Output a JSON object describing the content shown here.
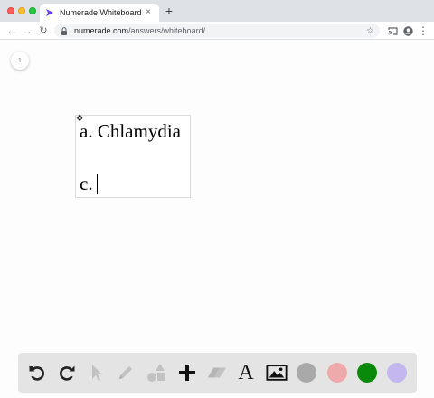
{
  "browser": {
    "tab_title": "Numerade Whiteboard",
    "tab_close": "×",
    "new_tab": "+",
    "url_host": "numerade.com",
    "url_path": "/answers/whiteboard/"
  },
  "whiteboard": {
    "page_number": "1",
    "textbox": {
      "line_1": "a. Chlamydia",
      "line_2": "c."
    }
  },
  "tools": {
    "icons": [
      "undo-icon",
      "redo-icon",
      "select-icon",
      "pen-icon",
      "shapes-icon",
      "add-icon",
      "eraser-icon",
      "text-icon",
      "image-icon"
    ],
    "text_tool_glyph": "A",
    "colors": {
      "gray": "#a9a9a9",
      "pink": "#eeaaaa",
      "green": "#0a8a0a",
      "lavender": "#c4b6ee"
    }
  }
}
